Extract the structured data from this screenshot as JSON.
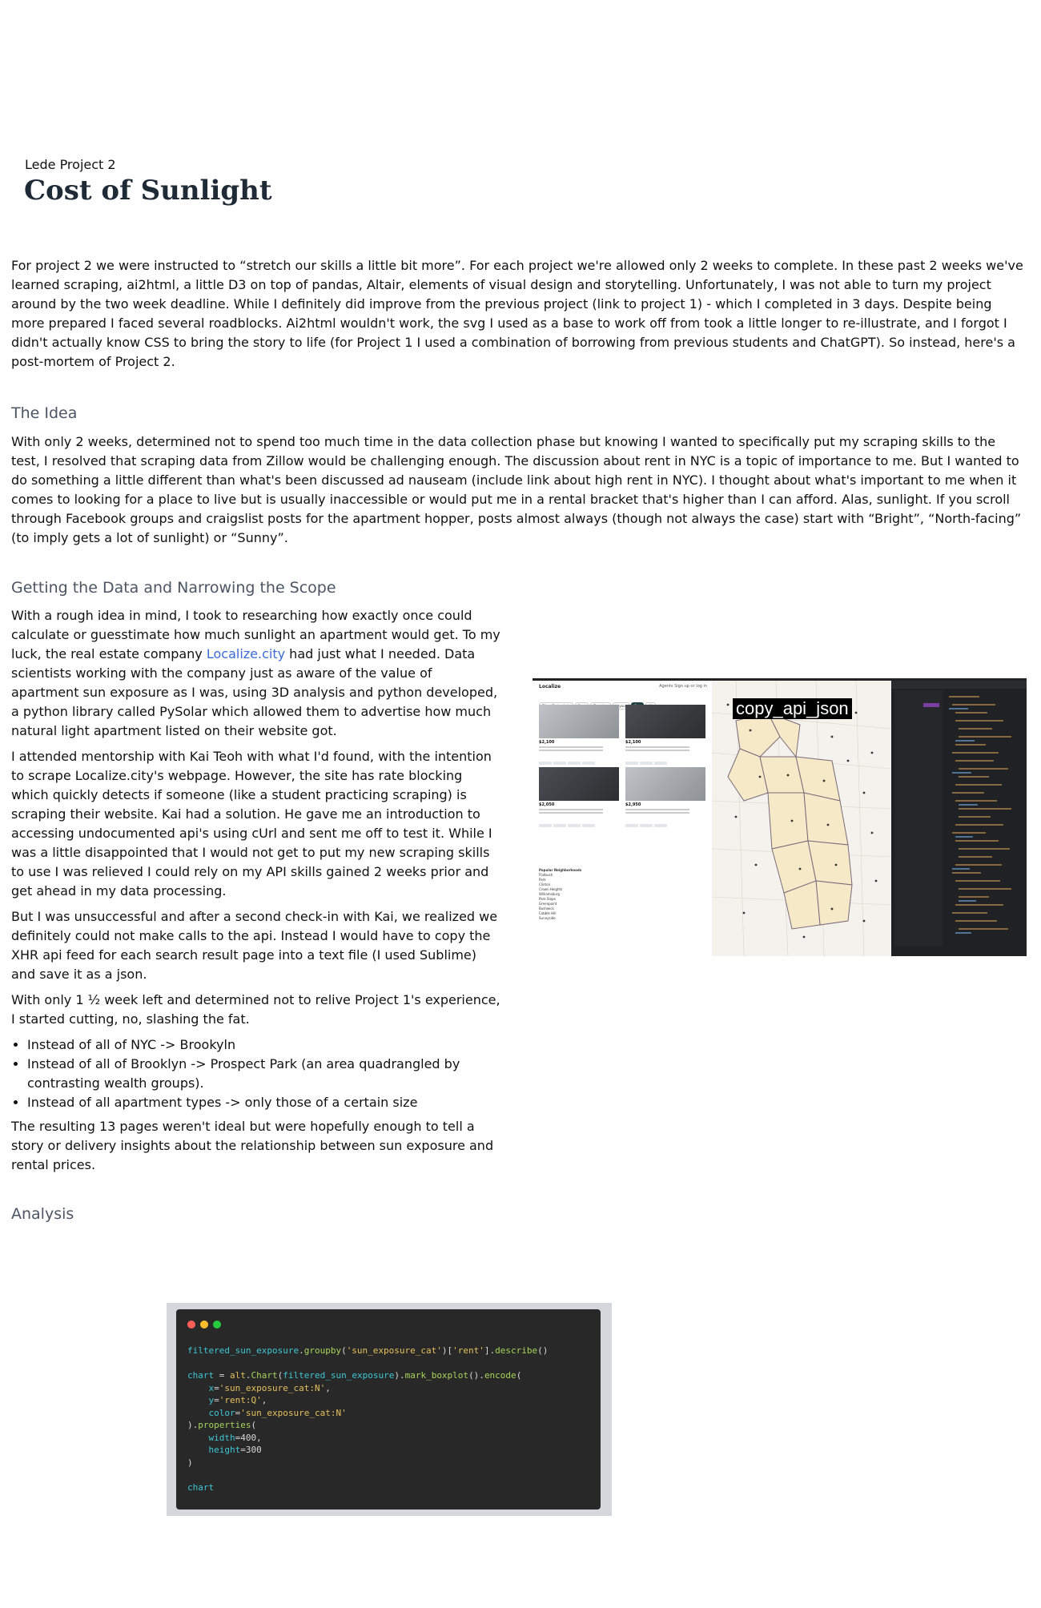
{
  "header": {
    "kicker": "Lede Project 2",
    "title": "Cost of Sunlight"
  },
  "intro": "For project 2 we were instructed to “stretch our skills a little bit more”. For each project we're allowed only 2 weeks to complete. In these past 2 weeks we've learned scraping, ai2html, a little D3 on top of pandas, Altair, elements of visual design and storytelling. Unfortunately, I was not able to turn my project around by the two week deadline. While I definitely did improve from the previous project (link to project 1) - which I completed in 3 days. Despite being more prepared I faced several roadblocks. Ai2html wouldn't work, the svg I used as a base to work off from took a little longer to re-illustrate, and I forgot I didn't actually know CSS to bring the story to life (for Project 1 I used a combination of borrowing from previous students and ChatGPT). So instead, here's a post-mortem of Project 2.",
  "idea": {
    "heading": "The Idea",
    "body": "With only 2 weeks, determined not to spend too much time in the data collection phase but knowing I wanted to specifically put my scraping skills to the test, I resolved that scraping data from Zillow would be challenging enough. The discussion about rent in NYC is a topic of importance to me. But I wanted to do something a little different than what's been discussed ad nauseam (include link about high rent in NYC). I thought about what's important to me when it comes to looking for a place to live but is usually inaccessible or would put me in a rental bracket that's higher than I can afford. Alas, sunlight. If you scroll through Facebook groups and craigslist posts for the apartment hopper, posts almost always (though not always the case) start with “Bright”, “North-facing” (to imply gets a lot of sunlight) or “Sunny”."
  },
  "scope": {
    "heading": "Getting the Data and Narrowing the Scope",
    "p1_before": "With a rough idea in mind, I took to researching how exactly once could calculate or guesstimate how much sunlight an apartment would get. To my luck, the real estate company ",
    "p1_link": "Localize.city",
    "p1_after": " had just what I needed. Data scientists working with the company just as aware of the value of apartment sun exposure as I was, using 3D analysis and python developed, a python library called PySolar which allowed them to advertise how much natural light apartment listed on their website got.",
    "p2": "I attended mentorship with Kai Teoh with what I'd found, with the intention to scrape Localize.city's webpage. However, the site has rate blocking which quickly detects if someone (like a student practicing scraping) is scraping their website. Kai had a solution. He gave me an introduction to accessing undocumented api's using cUrl and sent me off to test it. While I was a little disappointed that I would not get to put my new scraping skills to use I was relieved I could rely on my API skills gained 2 weeks prior and get ahead in my data processing.",
    "p3": "But I was unsuccessful and after a second check-in with Kai, we realized we definitely could not make calls to the api. Instead I would have to copy the XHR api feed for each search result page into a text file (I used Sublime) and save it as a json.",
    "p4": "With only 1 ½ week left and determined not to relive Project 1's experience, I started cutting, no, slashing the fat.",
    "bullets": [
      "Instead of all of NYC -> Brookyln",
      "Instead of all of Brooklyn -> Prospect Park (an area quadrangled by contrasting wealth groups).",
      "Instead of all apartment types -> only those of a certain size"
    ],
    "p5": "The resulting 13 pages weren't ideal but were hopefully enough to tell a story or delivery insights about the relationship between sun exposure and rental prices."
  },
  "figure": {
    "label": "copy_api_json",
    "brand": "Localize",
    "nav": "Agents   Sign up or log in",
    "chips": [
      "Filter (Budget) $$",
      "Rent",
      "Duration",
      "Layout",
      "Sun",
      "All"
    ],
    "prices": [
      "$2,100",
      "$2,100",
      "$2,050",
      "$2,950"
    ],
    "hood_title": "Popular Neighborhoods",
    "hoods": [
      "Flatbush",
      "Park",
      "Clinton",
      "Crown Heights",
      "Williamsburg",
      "Park Slope",
      "Greenpoint",
      "Bushwick",
      "Cobble Hill",
      "Sunnyside"
    ]
  },
  "analysis": {
    "heading": "Analysis"
  },
  "code": {
    "lines": [
      [
        [
          "c",
          "filtered_sun_exposure"
        ],
        [
          "w",
          "."
        ],
        [
          "g",
          "groupby"
        ],
        [
          "w",
          "("
        ],
        [
          "y",
          "'sun_exposure_cat'"
        ],
        [
          "w",
          ")["
        ],
        [
          "y",
          "'rent'"
        ],
        [
          "w",
          "]."
        ],
        [
          "g",
          "describe"
        ],
        [
          "w",
          "()"
        ]
      ],
      [],
      [
        [
          "c",
          "chart"
        ],
        [
          "w",
          " = "
        ],
        [
          "y",
          "alt"
        ],
        [
          "w",
          "."
        ],
        [
          "g",
          "Chart"
        ],
        [
          "w",
          "("
        ],
        [
          "c",
          "filtered_sun_exposure"
        ],
        [
          "w",
          ")."
        ],
        [
          "g",
          "mark_boxplot"
        ],
        [
          "w",
          "()."
        ],
        [
          "g",
          "encode"
        ],
        [
          "w",
          "("
        ]
      ],
      [
        [
          "w",
          "    "
        ],
        [
          "c",
          "x"
        ],
        [
          "w",
          "="
        ],
        [
          "y",
          "'sun_exposure_cat:N'"
        ],
        [
          "w",
          ","
        ]
      ],
      [
        [
          "w",
          "    "
        ],
        [
          "c",
          "y"
        ],
        [
          "w",
          "="
        ],
        [
          "y",
          "'rent:Q'"
        ],
        [
          "w",
          ","
        ]
      ],
      [
        [
          "w",
          "    "
        ],
        [
          "c",
          "color"
        ],
        [
          "w",
          "="
        ],
        [
          "y",
          "'sun_exposure_cat:N'"
        ]
      ],
      [
        [
          "w",
          ")."
        ],
        [
          "g",
          "properties"
        ],
        [
          "w",
          "("
        ]
      ],
      [
        [
          "w",
          "    "
        ],
        [
          "c",
          "width"
        ],
        [
          "w",
          "=400,"
        ]
      ],
      [
        [
          "w",
          "    "
        ],
        [
          "c",
          "height"
        ],
        [
          "w",
          "=300"
        ]
      ],
      [
        [
          "w",
          ")"
        ]
      ],
      [],
      [
        [
          "c",
          "chart"
        ]
      ]
    ],
    "dot_colors": [
      "#ff5f56",
      "#ffbd2e",
      "#27c93f"
    ]
  }
}
